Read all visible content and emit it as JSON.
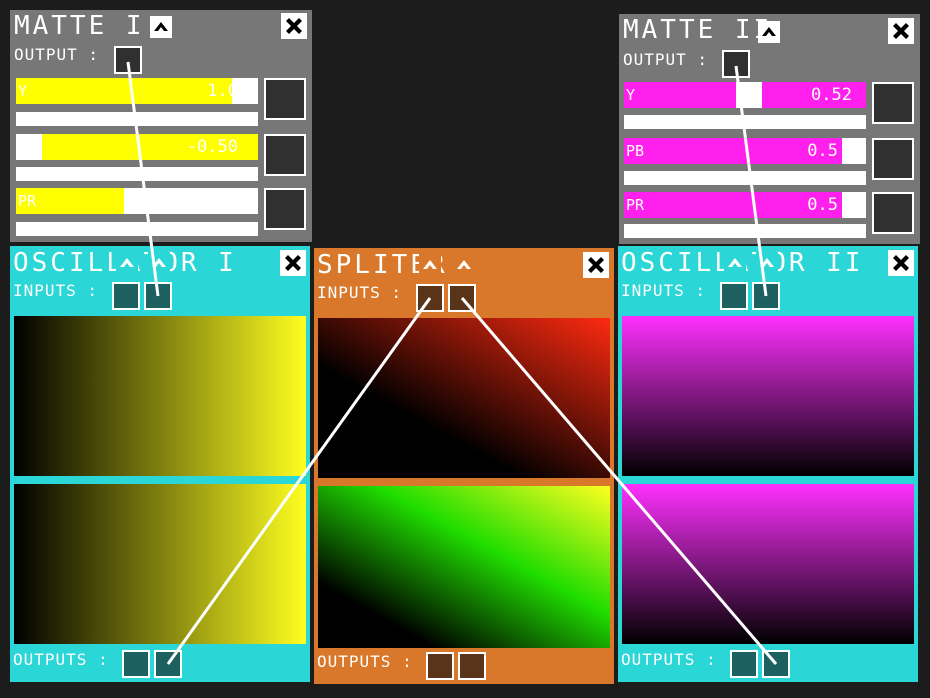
{
  "colors": {
    "background": "#1c1c1c",
    "matte_bg": "#777777",
    "oscillator_bg": "#2ad6d6",
    "spliter_bg": "#d9782a",
    "socket_dark_teal": "#1c6060",
    "socket_dark_brown": "#5a3418",
    "yellow": "#ffff00",
    "magenta": "#ff20ee",
    "wire": "#ffffff"
  },
  "matte1": {
    "title": "MATTE I",
    "output_label": "OUTPUT :",
    "sliders": [
      {
        "name": "Y",
        "value": "1.0",
        "fill": 0.95
      },
      {
        "name": "",
        "value": "-0.50",
        "fill": 0.0,
        "fill_from": 0.1
      },
      {
        "name": "PR",
        "value": "0.00",
        "fill": 0.45
      }
    ],
    "icons": {
      "collapse": "chevron-up-icon",
      "close": "close-icon"
    }
  },
  "matte2": {
    "title": "MATTE II",
    "output_label": "OUTPUT :",
    "sliders": [
      {
        "name": "Y",
        "value": "0.52",
        "fill": 0.5
      },
      {
        "name": "PB",
        "value": "0.5",
        "fill": 0.9
      },
      {
        "name": "PR",
        "value": "0.5",
        "fill": 0.9
      }
    ],
    "icons": {
      "collapse": "chevron-up-icon",
      "close": "close-icon"
    }
  },
  "osc1": {
    "title": "OSCILLATOR I",
    "inputs_label": "INPUTS :",
    "outputs_label": "OUTPUTS :",
    "preview_colors": [
      "#000000",
      "#ffff20"
    ]
  },
  "spliter": {
    "title": "SPLITER",
    "inputs_label": "INPUTS :",
    "outputs_label": "OUTPUTS :",
    "preview_top_colors": [
      "#000000",
      "#ff2a10"
    ],
    "preview_bottom_colors": [
      "#000000",
      "#20dd00",
      "#ffff20"
    ]
  },
  "osc2": {
    "title": "OSCILLATOR II",
    "inputs_label": "INPUTS :",
    "outputs_label": "OUTPUTS :",
    "preview_colors": [
      "#000000",
      "#ff30ff"
    ]
  }
}
